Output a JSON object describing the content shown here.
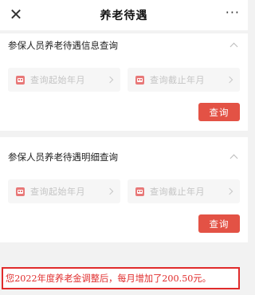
{
  "nav": {
    "close_icon": "close-icon",
    "title": "养老待遇",
    "more_label": "···"
  },
  "sections": [
    {
      "title": "参保人员养老待遇信息查询",
      "start_placeholder": "查询起始年月",
      "end_placeholder": "查询截止年月",
      "button_label": "查询"
    },
    {
      "title": "参保人员养老待遇明细查询",
      "start_placeholder": "查询起始年月",
      "end_placeholder": "查询截止年月",
      "button_label": "查询"
    }
  ],
  "notice": {
    "text": "您2022年度养老金调整后，每月增加了200.50元。"
  },
  "colors": {
    "accent": "#e35245",
    "notice_red": "#e02b2b",
    "icon_red": "#e87878",
    "placeholder_gray": "#c4c4c4"
  }
}
